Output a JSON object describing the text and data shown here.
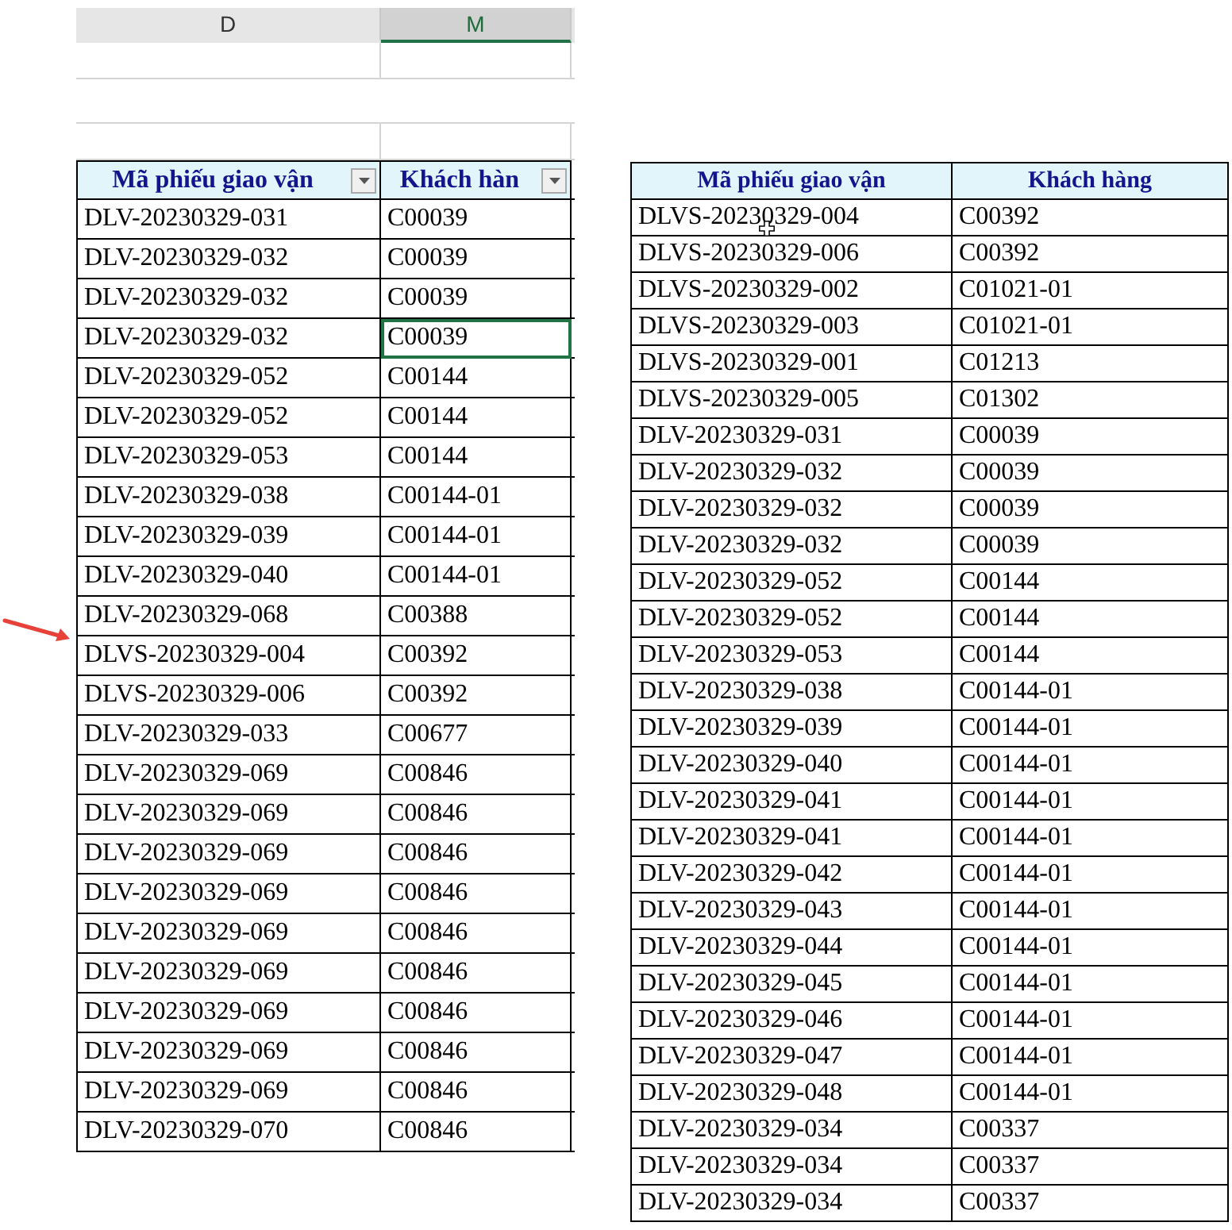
{
  "left_sheet": {
    "column_headers": [
      {
        "label": "D",
        "selected": false
      },
      {
        "label": "M",
        "selected": true
      }
    ],
    "columns": [
      "Mã phiếu giao vận",
      "Khách hàn"
    ],
    "rows": [
      {
        "id": "DLV-20230329-031",
        "customer": "C00039",
        "customer_selected": false
      },
      {
        "id": "DLV-20230329-032",
        "customer": "C00039",
        "customer_selected": false
      },
      {
        "id": "DLV-20230329-032",
        "customer": "C00039",
        "customer_selected": false
      },
      {
        "id": "DLV-20230329-032",
        "customer": "C00039",
        "customer_selected": true
      },
      {
        "id": "DLV-20230329-052",
        "customer": "C00144",
        "customer_selected": false
      },
      {
        "id": "DLV-20230329-052",
        "customer": "C00144",
        "customer_selected": false
      },
      {
        "id": "DLV-20230329-053",
        "customer": "C00144",
        "customer_selected": false
      },
      {
        "id": "DLV-20230329-038",
        "customer": "C00144-01",
        "customer_selected": false
      },
      {
        "id": "DLV-20230329-039",
        "customer": "C00144-01",
        "customer_selected": false
      },
      {
        "id": "DLV-20230329-040",
        "customer": "C00144-01",
        "customer_selected": false
      },
      {
        "id": "DLV-20230329-068",
        "customer": "C00388",
        "customer_selected": false
      },
      {
        "id": "DLVS-20230329-004",
        "customer": "C00392",
        "customer_selected": false
      },
      {
        "id": "DLVS-20230329-006",
        "customer": "C00392",
        "customer_selected": false
      },
      {
        "id": "DLV-20230329-033",
        "customer": "C00677",
        "customer_selected": false
      },
      {
        "id": "DLV-20230329-069",
        "customer": "C00846",
        "customer_selected": false
      },
      {
        "id": "DLV-20230329-069",
        "customer": "C00846",
        "customer_selected": false
      },
      {
        "id": "DLV-20230329-069",
        "customer": "C00846",
        "customer_selected": false
      },
      {
        "id": "DLV-20230329-069",
        "customer": "C00846",
        "customer_selected": false
      },
      {
        "id": "DLV-20230329-069",
        "customer": "C00846",
        "customer_selected": false
      },
      {
        "id": "DLV-20230329-069",
        "customer": "C00846",
        "customer_selected": false
      },
      {
        "id": "DLV-20230329-069",
        "customer": "C00846",
        "customer_selected": false
      },
      {
        "id": "DLV-20230329-069",
        "customer": "C00846",
        "customer_selected": false
      },
      {
        "id": "DLV-20230329-069",
        "customer": "C00846",
        "customer_selected": false
      },
      {
        "id": "DLV-20230329-070",
        "customer": "C00846",
        "customer_selected": false
      }
    ]
  },
  "right_table": {
    "columns": [
      "Mã phiếu giao vận",
      "Khách hàng"
    ],
    "rows": [
      [
        "DLVS-20230329-004",
        "C00392"
      ],
      [
        "DLVS-20230329-006",
        "C00392"
      ],
      [
        "DLVS-20230329-002",
        "C01021-01"
      ],
      [
        "DLVS-20230329-003",
        "C01021-01"
      ],
      [
        "DLVS-20230329-001",
        "C01213"
      ],
      [
        "DLVS-20230329-005",
        "C01302"
      ],
      [
        "DLV-20230329-031",
        "C00039"
      ],
      [
        "DLV-20230329-032",
        "C00039"
      ],
      [
        "DLV-20230329-032",
        "C00039"
      ],
      [
        "DLV-20230329-032",
        "C00039"
      ],
      [
        "DLV-20230329-052",
        "C00144"
      ],
      [
        "DLV-20230329-052",
        "C00144"
      ],
      [
        "DLV-20230329-053",
        "C00144"
      ],
      [
        "DLV-20230329-038",
        "C00144-01"
      ],
      [
        "DLV-20230329-039",
        "C00144-01"
      ],
      [
        "DLV-20230329-040",
        "C00144-01"
      ],
      [
        "DLV-20230329-041",
        "C00144-01"
      ],
      [
        "DLV-20230329-041",
        "C00144-01"
      ],
      [
        "DLV-20230329-042",
        "C00144-01"
      ],
      [
        "DLV-20230329-043",
        "C00144-01"
      ],
      [
        "DLV-20230329-044",
        "C00144-01"
      ],
      [
        "DLV-20230329-045",
        "C00144-01"
      ],
      [
        "DLV-20230329-046",
        "C00144-01"
      ],
      [
        "DLV-20230329-047",
        "C00144-01"
      ],
      [
        "DLV-20230329-048",
        "C00144-01"
      ],
      [
        "DLV-20230329-034",
        "C00337"
      ],
      [
        "DLV-20230329-034",
        "C00337"
      ],
      [
        "DLV-20230329-034",
        "C00337"
      ]
    ]
  }
}
